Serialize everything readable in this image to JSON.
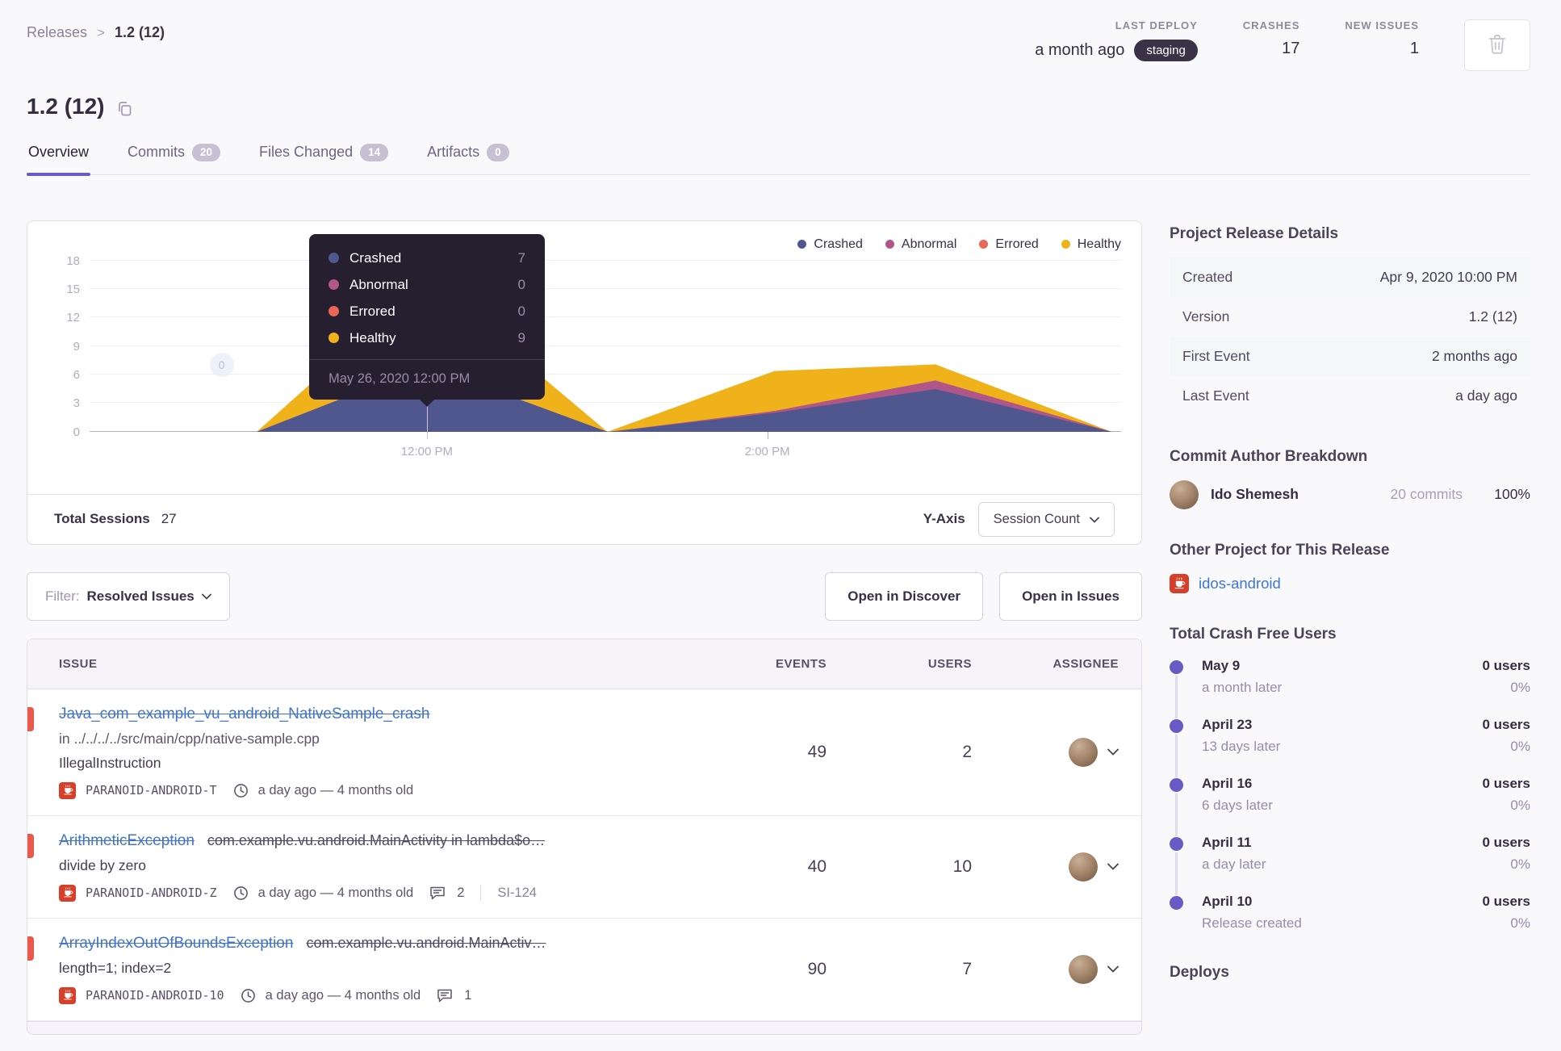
{
  "breadcrumb": {
    "parent": "Releases",
    "current": "1.2 (12)"
  },
  "header": {
    "stats": [
      {
        "label": "LAST DEPLOY",
        "value": "a month ago",
        "badge": "staging"
      },
      {
        "label": "CRASHES",
        "value": "17"
      },
      {
        "label": "NEW ISSUES",
        "value": "1"
      }
    ]
  },
  "title": "1.2 (12)",
  "tabs": [
    {
      "label": "Overview",
      "active": true
    },
    {
      "label": "Commits",
      "badge": "20"
    },
    {
      "label": "Files Changed",
      "badge": "14"
    },
    {
      "label": "Artifacts",
      "badge": "0"
    }
  ],
  "chart_data": {
    "type": "area",
    "stacked": true,
    "title": "Release sessions over time",
    "y_max": 18,
    "y_ticks": [
      0,
      3,
      6,
      9,
      12,
      15,
      18
    ],
    "x_ticks": [
      {
        "label": "12:00 PM",
        "pos": 0.327
      },
      {
        "label": "2:00 PM",
        "pos": 0.657
      }
    ],
    "series_order": [
      "crashed",
      "abnormal",
      "errored",
      "healthy"
    ],
    "series_labels": {
      "crashed": "Crashed",
      "abnormal": "Abnormal",
      "errored": "Errored",
      "healthy": "Healthy"
    },
    "colors": {
      "crashed": "#50578f",
      "abnormal": "#b05688",
      "errored": "#ea6657",
      "healthy": "#f0b21b"
    },
    "legend": [
      "Crashed",
      "Abnormal",
      "Errored",
      "Healthy"
    ],
    "points": [
      {
        "pos": 0.162,
        "crashed": 0,
        "abnormal": 0,
        "errored": 0,
        "healthy": 0
      },
      {
        "pos": 0.327,
        "crashed": 7,
        "abnormal": 0,
        "errored": 0,
        "healthy": 9
      },
      {
        "pos": 0.502,
        "crashed": 0,
        "abnormal": 0,
        "errored": 0,
        "healthy": 0
      },
      {
        "pos": 0.512,
        "crashed": 0.1,
        "abnormal": 0,
        "errored": 0,
        "healthy": 0.3
      },
      {
        "pos": 0.664,
        "crashed": 2.0,
        "abnormal": 0.2,
        "errored": 0,
        "healthy": 4.2
      },
      {
        "pos": 0.82,
        "crashed": 4.5,
        "abnormal": 0.9,
        "errored": 0,
        "healthy": 1.7
      },
      {
        "pos": 0.991,
        "crashed": 0,
        "abnormal": 0,
        "errored": 0,
        "healthy": 0
      }
    ],
    "marker": {
      "label": "0",
      "pos": 0.128,
      "y_frac": 0.61
    },
    "tooltip": {
      "rows": [
        {
          "label": "Crashed",
          "value": "7"
        },
        {
          "label": "Abnormal",
          "value": "0"
        },
        {
          "label": "Errored",
          "value": "0"
        },
        {
          "label": "Healthy",
          "value": "9"
        }
      ],
      "footer": "May 26, 2020 12:00 PM"
    },
    "total_sessions": 27
  },
  "chart_footer": {
    "total_label": "Total Sessions",
    "total_value": "27",
    "yaxis_label": "Y-Axis",
    "yaxis_value": "Session Count"
  },
  "filter": {
    "label": "Filter:",
    "value": "Resolved Issues"
  },
  "actions": {
    "discover": "Open in Discover",
    "issues": "Open in Issues"
  },
  "issues_table": {
    "columns": [
      "Issue",
      "Events",
      "Users",
      "Assignee"
    ],
    "rows": [
      {
        "title": "Java_com_example_vu_android_NativeSample_crash",
        "location": "in ../../../../src/main/cpp/native-sample.cpp",
        "detail": "IllegalInstruction",
        "project": "PARANOID-ANDROID-T",
        "age": "a day ago — 4 months old",
        "events": "49",
        "users": "2"
      },
      {
        "title": "ArithmeticException",
        "culprit": "com.example.vu.android.MainActivity in lambda$o…",
        "detail": "divide by zero",
        "project": "PARANOID-ANDROID-Z",
        "age": "a day ago — 4 months old",
        "comments": "2",
        "annotation": "SI-124",
        "events": "40",
        "users": "10"
      },
      {
        "title": "ArrayIndexOutOfBoundsException",
        "culprit": "com.example.vu.android.MainActiv…",
        "detail": "length=1; index=2",
        "project": "PARANOID-ANDROID-10",
        "age": "a day ago — 4 months old",
        "comments": "1",
        "events": "90",
        "users": "7"
      }
    ]
  },
  "sidebar": {
    "release_details": {
      "title": "Project Release Details",
      "rows": [
        {
          "label": "Created",
          "value": "Apr 9, 2020 10:00 PM"
        },
        {
          "label": "Version",
          "value": "1.2 (12)"
        },
        {
          "label": "First Event",
          "value": "2 months ago"
        },
        {
          "label": "Last Event",
          "value": "a day ago"
        }
      ]
    },
    "commit_authors": {
      "title": "Commit Author Breakdown",
      "author": {
        "name": "Ido Shemesh",
        "commits": "20 commits",
        "percent": "100%"
      }
    },
    "other_project": {
      "title": "Other Project for This Release",
      "name": "idos-android"
    },
    "crash_free": {
      "title": "Total Crash Free Users",
      "entries": [
        {
          "date": "May 9",
          "sub": "a month later",
          "users": "0 users",
          "percent": "0%"
        },
        {
          "date": "April 23",
          "sub": "13 days later",
          "users": "0 users",
          "percent": "0%"
        },
        {
          "date": "April 16",
          "sub": "6 days later",
          "users": "0 users",
          "percent": "0%"
        },
        {
          "date": "April 11",
          "sub": "a day later",
          "users": "0 users",
          "percent": "0%"
        },
        {
          "date": "April 10",
          "sub": "Release created",
          "users": "0 users",
          "percent": "0%"
        }
      ]
    },
    "deploys_title": "Deploys"
  }
}
